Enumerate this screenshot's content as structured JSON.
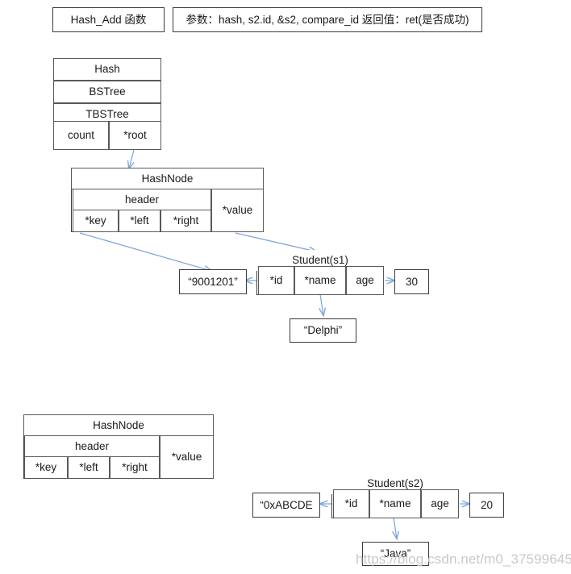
{
  "diagram": {
    "title_box": {
      "text": "Hash_Add 函数"
    },
    "params_box": {
      "text": "参数：hash, s2.id, &s2, compare_id  返回值：ret(是否成功)"
    },
    "hash_struct": {
      "rows": [
        "Hash",
        "BSTree",
        "TBSTree"
      ],
      "count_label": "count",
      "root_label": "*root"
    },
    "hashnode1": {
      "title": "HashNode",
      "header": "header",
      "value": "*value",
      "key": "*key",
      "left": "*left",
      "right": "*right"
    },
    "hashnode2": {
      "title": "HashNode",
      "header": "header",
      "value": "*value",
      "key": "*key",
      "left": "*left",
      "right": "*right"
    },
    "student1": {
      "title": "Student(s1)",
      "id": "*id",
      "name": "*name",
      "age": "age"
    },
    "student2": {
      "title": "Student(s2)",
      "id": "*id",
      "name": "*name",
      "age": "age"
    },
    "key_value_1": "“9001201”",
    "age_value_1": "30",
    "name_value_1": "“Delphi”",
    "key_value_2": "“0xABCDE",
    "age_value_2": "20",
    "name_value_2": "“Java”",
    "watermark": "https://blog.csdn.net/m0_37599645",
    "colors": {
      "arrow": "#7da7d9",
      "border": "#3b3b3b",
      "cell_border": "#595959",
      "watermark": "#c9c9c9"
    }
  }
}
